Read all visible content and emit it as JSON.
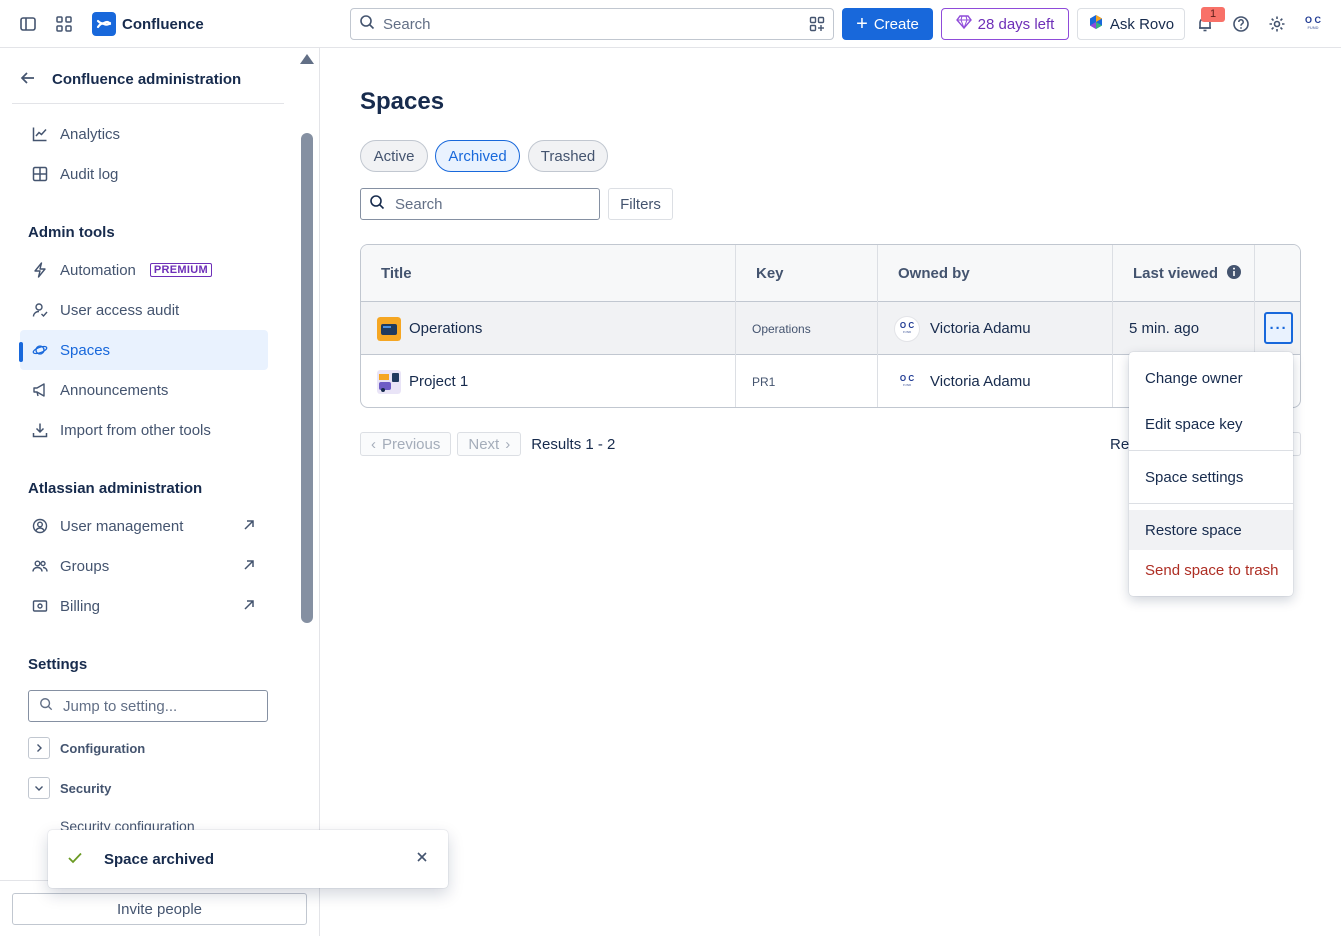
{
  "topbar": {
    "brand": "Confluence",
    "search_placeholder": "Search",
    "create_label": "Create",
    "trial_label": "28 days left",
    "rovo_label": "Ask Rovo",
    "notification_count": "1",
    "avatar_initials": "O C",
    "avatar_sub": "FUND"
  },
  "sidebar": {
    "header": "Confluence administration",
    "top_items": [
      {
        "label": "Analytics",
        "icon": "chart-line-icon"
      },
      {
        "label": "Audit log",
        "icon": "grid-icon"
      }
    ],
    "admin_tools_title": "Admin tools",
    "admin_tools": [
      {
        "label": "Automation",
        "icon": "lightning-icon",
        "badge": "PREMIUM"
      },
      {
        "label": "User access audit",
        "icon": "user-check-icon"
      },
      {
        "label": "Spaces",
        "icon": "planet-icon"
      },
      {
        "label": "Announcements",
        "icon": "megaphone-icon"
      },
      {
        "label": "Import from other tools",
        "icon": "download-icon"
      }
    ],
    "atlassian_title": "Atlassian administration",
    "atlassian": [
      {
        "label": "User management",
        "icon": "user-circle-icon"
      },
      {
        "label": "Groups",
        "icon": "people-icon"
      },
      {
        "label": "Billing",
        "icon": "billing-icon"
      }
    ],
    "settings_title": "Settings",
    "jump_placeholder": "Jump to setting...",
    "tree": [
      {
        "label": "Configuration",
        "expanded": false
      },
      {
        "label": "Security",
        "expanded": true
      }
    ],
    "sub_item": "Security configuration",
    "invite_label": "Invite people"
  },
  "main": {
    "title": "Spaces",
    "tabs": [
      {
        "label": "Active",
        "selected": false
      },
      {
        "label": "Archived",
        "selected": true
      },
      {
        "label": "Trashed",
        "selected": false
      }
    ],
    "search_placeholder": "Search",
    "filters_label": "Filters",
    "columns": [
      "Title",
      "Key",
      "Owned by",
      "Last viewed"
    ],
    "rows": [
      {
        "title": "Operations",
        "key": "Operations",
        "owner": "Victoria Adamu",
        "last_viewed": "5 min. ago"
      },
      {
        "title": "Project 1",
        "key": "PR1",
        "owner": "Victoria Adamu",
        "last_viewed": ""
      }
    ],
    "more_label": "···",
    "pagination": {
      "previous": "Previous",
      "next": "Next",
      "results": "Results 1 - 2",
      "results_right": "Res"
    }
  },
  "menu": {
    "items": [
      "Change owner",
      "Edit space key",
      "Space settings",
      "Restore space",
      "Send space to trash"
    ]
  },
  "toast": {
    "message": "Space archived"
  },
  "colors": {
    "brand": "#1868db",
    "danger": "#ae2e24",
    "success": "#6a9a23",
    "premium": "#6e2fb8"
  }
}
